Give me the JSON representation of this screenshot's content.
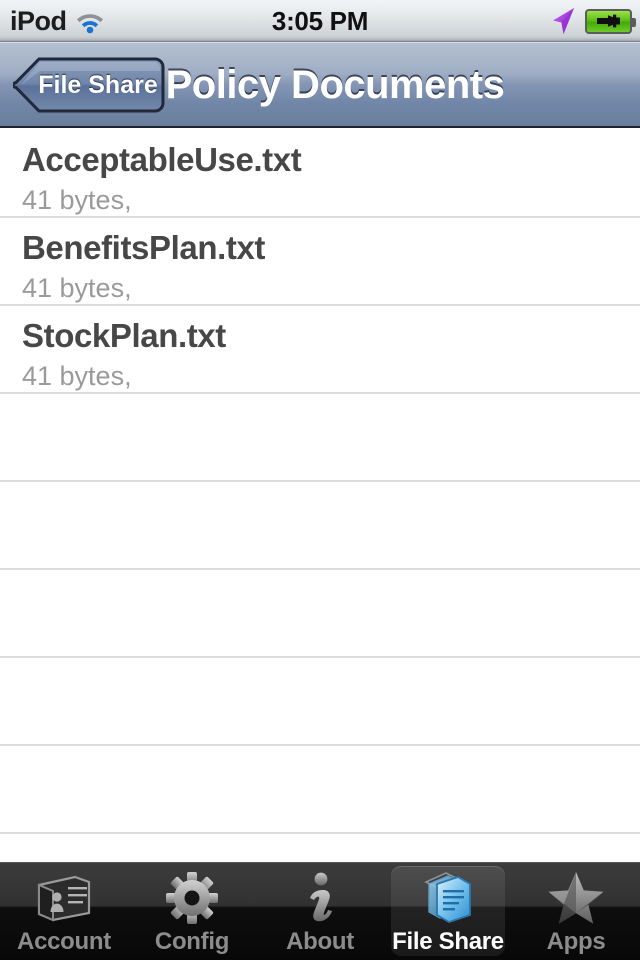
{
  "status_bar": {
    "carrier": "iPod",
    "wifi_icon": "wifi-icon",
    "time": "3:05 PM",
    "location_icon": "location-arrow-icon",
    "battery_icon": "battery-charging-icon"
  },
  "nav_bar": {
    "back_label": "File Share",
    "title": "Policy Documents"
  },
  "list": {
    "rows": [
      {
        "title": "AcceptableUse.txt",
        "subtitle": "41 bytes,"
      },
      {
        "title": "BenefitsPlan.txt",
        "subtitle": "41 bytes,"
      },
      {
        "title": "StockPlan.txt",
        "subtitle": "41 bytes,"
      }
    ],
    "empty_row_count": 5
  },
  "tab_bar": {
    "selected": "File Share",
    "tabs": [
      {
        "label": "Account",
        "icon": "contact-card-icon"
      },
      {
        "label": "Config",
        "icon": "gear-icon"
      },
      {
        "label": "About",
        "icon": "info-i-icon"
      },
      {
        "label": "File Share",
        "icon": "documents-icon"
      },
      {
        "label": "Apps",
        "icon": "star-icon"
      }
    ]
  },
  "colors": {
    "nav_top": "#b5c1d2",
    "nav_bottom": "#6a7e9c",
    "row_title": "#474747",
    "row_subtitle": "#9a9a9a",
    "separator": "#dcdcdc",
    "tab_selected_accent": "#5bb8e8",
    "battery_green": "#5bbf17",
    "location_purple": "#a23ad6"
  }
}
